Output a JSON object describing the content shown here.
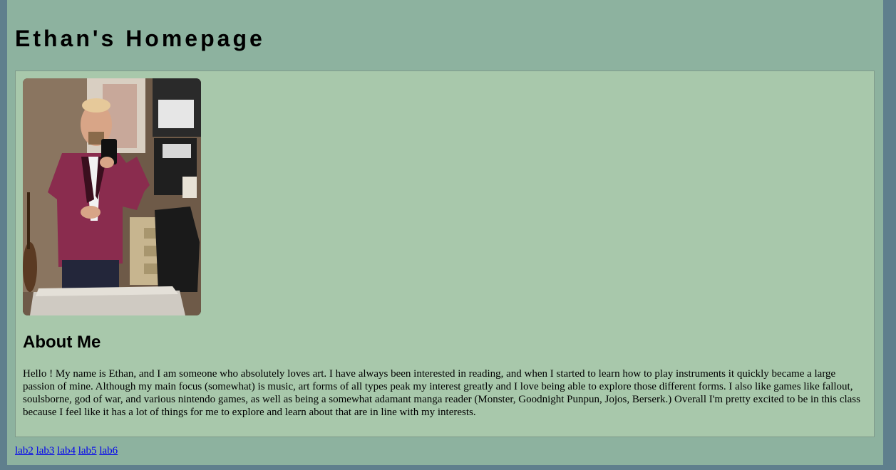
{
  "header": {
    "title": "Ethan's Homepage"
  },
  "profile": {
    "photo_description_icon": "profile-photo"
  },
  "about": {
    "heading": "About Me",
    "body": "Hello ! My name is Ethan, and I am someone who absolutely loves art. I have always been interested in reading, and when I started to learn how to play instruments it quickly became a large passion of mine. Although my main focus (somewhat) is music, art forms of all types peak my interest greatly and I love being able to explore those different forms. I also like games like fallout, soulsborne, god of war, and various nintendo games, as well as being a somewhat adamant manga reader (Monster, Goodnight Punpun, Jojos, Berserk.) Overall I'm pretty excited to be in this class because I feel like it has a lot of things for me to explore and learn about that are in line with my interests."
  },
  "nav": {
    "links": [
      {
        "label": "lab2"
      },
      {
        "label": "lab3"
      },
      {
        "label": "lab4"
      },
      {
        "label": "lab5"
      },
      {
        "label": "lab6"
      }
    ]
  },
  "colors": {
    "outer_background": "#5f7f8d",
    "page_background": "#8db29f",
    "content_background": "#a8c8ab",
    "link": "#0000ee"
  }
}
